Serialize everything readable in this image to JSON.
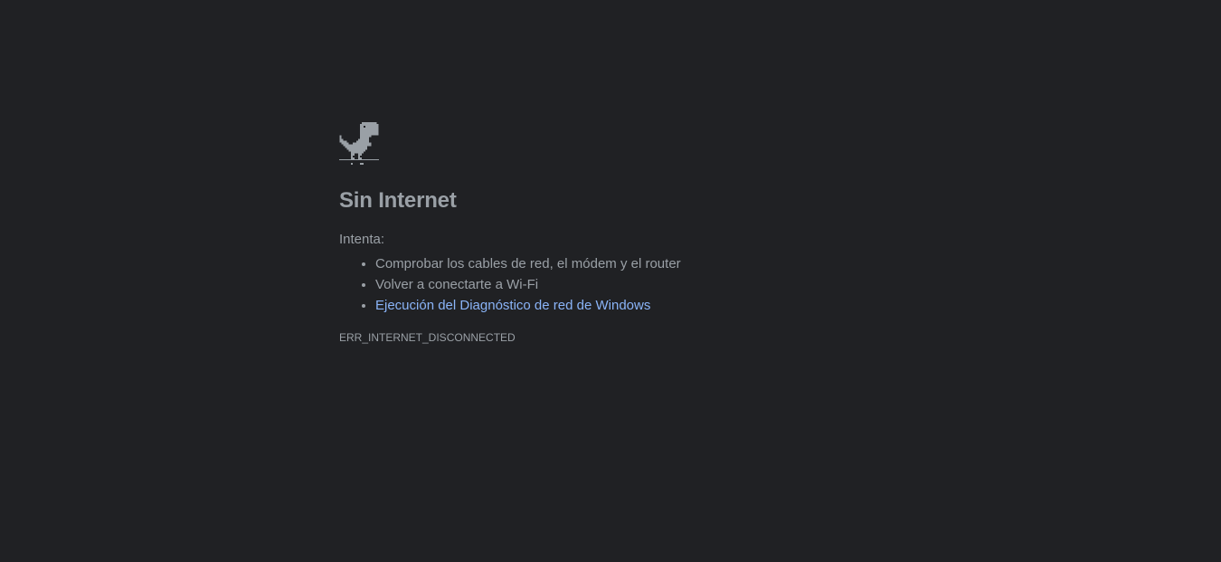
{
  "icon": "offline-dino-icon",
  "title": "Sin Internet",
  "try_label": "Intenta:",
  "suggestions": [
    "Comprobar los cables de red, el módem y el router",
    "Volver a conectarte a Wi-Fi"
  ],
  "diagnostics_link": "Ejecución del Diagnóstico de red de Windows",
  "error_code": "ERR_INTERNET_DISCONNECTED",
  "colors": {
    "background": "#202124",
    "text": "#9aa0a6",
    "link": "#8ab4f8"
  }
}
